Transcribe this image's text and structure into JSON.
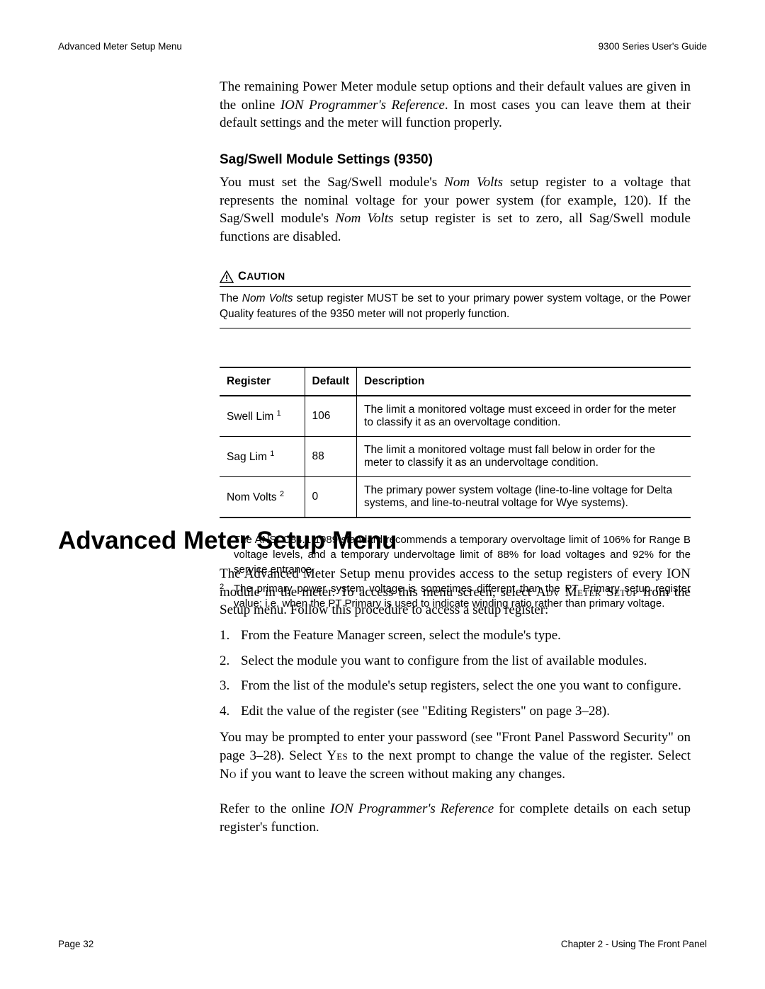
{
  "header": {
    "left": "Advanced Meter Setup Menu",
    "right": "9300 Series User's Guide"
  },
  "intro": {
    "p1a": "The remaining Power Meter module setup options and their default values are given in the online ",
    "p1_ital": "ION Programmer's Reference",
    "p1b": ". In most cases you can leave them at their default settings and the meter will function properly."
  },
  "sag": {
    "heading": "Sag/Swell Module Settings (9350)",
    "p_a": "You must set the Sag/Swell module's ",
    "p_it1": "Nom Volts",
    "p_b": " setup register to a voltage that represents the nominal voltage for your power system (for example, 120). If the Sag/Swell module's ",
    "p_it2": "Nom Volts",
    "p_c": " setup register is set to zero, all Sag/Swell module functions are disabled."
  },
  "caution": {
    "label_upper": "C",
    "label_rest": "AUTION",
    "t_a": "The ",
    "t_it": "Nom Volts",
    "t_b": " setup register MUST be set to your primary power system voltage, or the Power Quality features of the 9350 meter will not properly function."
  },
  "table": {
    "headers": {
      "reg": "Register",
      "def": "Default",
      "desc": "Description"
    },
    "rows": [
      {
        "reg": "Swell Lim",
        "sup": "1",
        "def": "106",
        "desc": "The limit a monitored voltage must exceed in order for the meter to classify it as an overvoltage condition."
      },
      {
        "reg": "Sag Lim",
        "sup": "1",
        "def": "88",
        "desc": "The limit a monitored voltage must fall below in order for the meter to classify it as an undervoltage condition."
      },
      {
        "reg": "Nom Volts",
        "sup": "2",
        "def": "0",
        "desc": "The primary power system voltage (line-to-line voltage for Delta systems, and line-to-neutral voltage for Wye systems)."
      }
    ]
  },
  "footnotes": [
    {
      "mark": "1",
      "text": "The ANSI C84.1 1989 standard recommends a temporary overvoltage limit of 106% for Range B voltage levels, and a temporary undervoltage limit of 88% for load voltages and 92% for the service entrance."
    },
    {
      "mark": "2",
      "text": "The primary power system voltage is sometimes different than the PT Primary setup register value; i.e. when the PT Primary is used to indicate winding ratio rather than primary voltage."
    }
  ],
  "h1": "Advanced Meter Setup Menu",
  "adv": {
    "p1_a": "The Advanced Meter Setup menu provides access to the setup registers of every ION module in the meter. To access this menu screen, select ",
    "p1_sc": "Adv Meter Setup",
    "p1_b": " from the Setup menu. Follow this procedure to access a setup register:",
    "steps": [
      {
        "n": "1.",
        "t": "From the Feature Manager screen, select the module's type."
      },
      {
        "n": "2.",
        "t": "Select the module you want to configure from the list of available modules."
      },
      {
        "n": "3.",
        "t": "From the list of the module's setup registers, select the one you want to configure."
      },
      {
        "n": "4.",
        "t": "Edit the value of the register (see \"Editing Registers\" on page 3–28)."
      }
    ],
    "p2_a": "You may be prompted to enter your password (see \"Front Panel Password Security\" on page 3–28). Select ",
    "p2_yes": "Yes",
    "p2_b": " to the next prompt to change the value of the register. Select ",
    "p2_no": "No",
    "p2_c": " if you want to leave the screen without making any changes.",
    "p3_a": "Refer to the online ",
    "p3_it": "ION Programmer's Reference",
    "p3_b": " for complete details on each setup register's function."
  },
  "footer": {
    "left": "Page 32",
    "right": "Chapter 2 - Using The Front Panel"
  }
}
